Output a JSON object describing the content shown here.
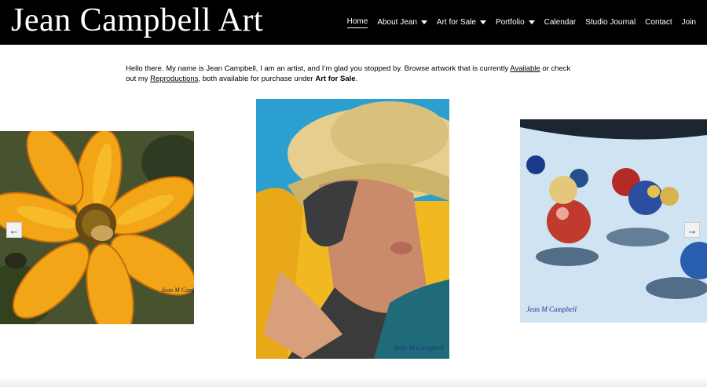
{
  "header": {
    "site_title": "Jean Campbell Art",
    "nav": [
      {
        "label": "Home",
        "active": true,
        "dropdown": false
      },
      {
        "label": "About Jean",
        "active": false,
        "dropdown": true
      },
      {
        "label": "Art for Sale",
        "active": false,
        "dropdown": true
      },
      {
        "label": "Portfolio",
        "active": false,
        "dropdown": true
      },
      {
        "label": "Calendar",
        "active": false,
        "dropdown": false
      },
      {
        "label": "Studio Journal",
        "active": false,
        "dropdown": false
      },
      {
        "label": "Contact",
        "active": false,
        "dropdown": false
      },
      {
        "label": "Join",
        "active": false,
        "dropdown": false
      }
    ]
  },
  "intro": {
    "part1": "Hello there. My name is Jean Campbell, I am an artist, and I’m glad you stopped by. Browse artwork that is currently ",
    "link_available": "Available",
    "part2": " or check out my ",
    "link_reproductions": "Reproductions",
    "part3": ", both available for purchase under ",
    "bold_art_for_sale": "Art for Sale",
    "part4": "."
  },
  "gallery": {
    "prev_arrow": "←",
    "next_arrow": "→",
    "slides": [
      {
        "subject": "yellow-flower-with-bee",
        "signature": "Jean M Campbell"
      },
      {
        "subject": "woman-in-straw-hat",
        "signature": "Jean M Campbell"
      },
      {
        "subject": "marbles-on-blue",
        "signature": "Jean M Campbell"
      }
    ]
  },
  "colors": {
    "header_bg": "#000000",
    "header_text": "#ffffff",
    "page_bg": "#ffffff"
  }
}
